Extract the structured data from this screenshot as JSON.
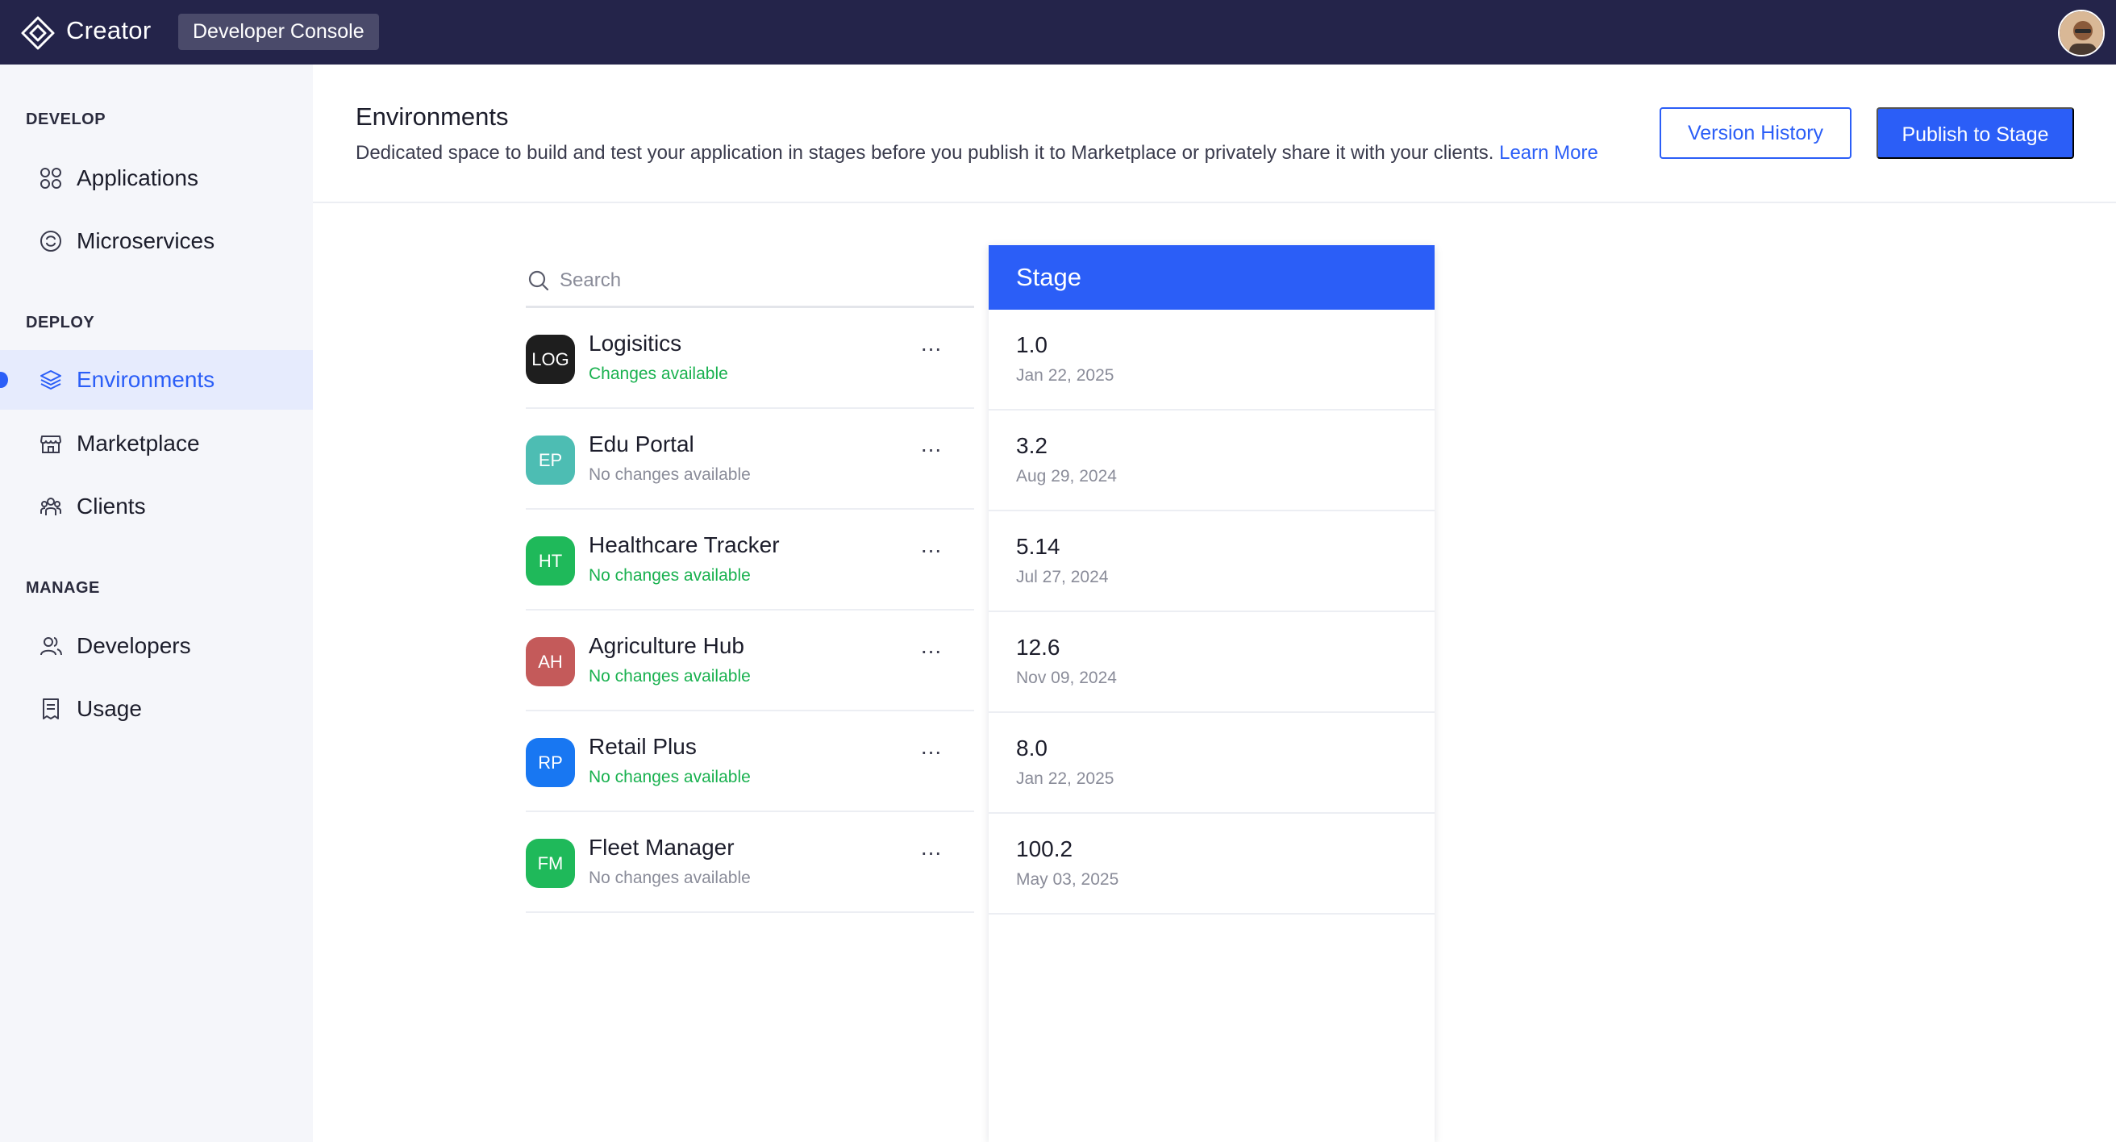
{
  "topbar": {
    "app_name": "Creator",
    "console_label": "Developer Console"
  },
  "sidebar": {
    "sections": [
      {
        "label": "DEVELOP",
        "items": [
          {
            "label": "Applications",
            "icon": "grid-icon"
          },
          {
            "label": "Microservices",
            "icon": "microservices-icon"
          }
        ]
      },
      {
        "label": "DEPLOY",
        "items": [
          {
            "label": "Environments",
            "icon": "layers-icon",
            "active": true
          },
          {
            "label": "Marketplace",
            "icon": "store-icon"
          },
          {
            "label": "Clients",
            "icon": "clients-icon"
          }
        ]
      },
      {
        "label": "MANAGE",
        "items": [
          {
            "label": "Developers",
            "icon": "users-icon"
          },
          {
            "label": "Usage",
            "icon": "usage-icon"
          }
        ]
      }
    ]
  },
  "header": {
    "title": "Environments",
    "description": "Dedicated space to build and test your application in stages before you publish it to Marketplace or privately share it with your clients.",
    "learn_more": "Learn More",
    "version_history_label": "Version History",
    "publish_label": "Publish to Stage"
  },
  "search": {
    "placeholder": "Search"
  },
  "apps": [
    {
      "initials": "LOG",
      "name": "Logisitics",
      "status": "Changes available",
      "status_color": "green",
      "avatar_color": "#1e1e1e"
    },
    {
      "initials": "EP",
      "name": "Edu Portal",
      "status": "No changes available",
      "status_color": "gray",
      "avatar_color": "#4dbdb3"
    },
    {
      "initials": "HT",
      "name": "Healthcare Tracker",
      "status": "No changes available",
      "status_color": "green",
      "avatar_color": "#1fb95a"
    },
    {
      "initials": "AH",
      "name": "Agriculture Hub",
      "status": "No changes available",
      "status_color": "green",
      "avatar_color": "#c45a5a"
    },
    {
      "initials": "RP",
      "name": "Retail Plus",
      "status": "No changes available",
      "status_color": "green",
      "avatar_color": "#1877f2"
    },
    {
      "initials": "FM",
      "name": "Fleet Manager",
      "status": "No changes available",
      "status_color": "gray",
      "avatar_color": "#1fb95a"
    }
  ],
  "more_label": "...",
  "stage": {
    "title": "Stage",
    "rows": [
      {
        "version": "1.0",
        "date": "Jan 22, 2025"
      },
      {
        "version": "3.2",
        "date": "Aug 29, 2024"
      },
      {
        "version": "5.14",
        "date": "Jul 27, 2024"
      },
      {
        "version": "12.6",
        "date": "Nov 09, 2024"
      },
      {
        "version": "8.0",
        "date": "Jan 22, 2025"
      },
      {
        "version": "100.2",
        "date": "May 03, 2025"
      }
    ]
  },
  "colors": {
    "topbar": "#24244a",
    "accent": "#2b5ef7",
    "sidebar_bg": "#f5f6fa",
    "status_green": "#19b14f",
    "status_gray": "#8a8c99"
  }
}
